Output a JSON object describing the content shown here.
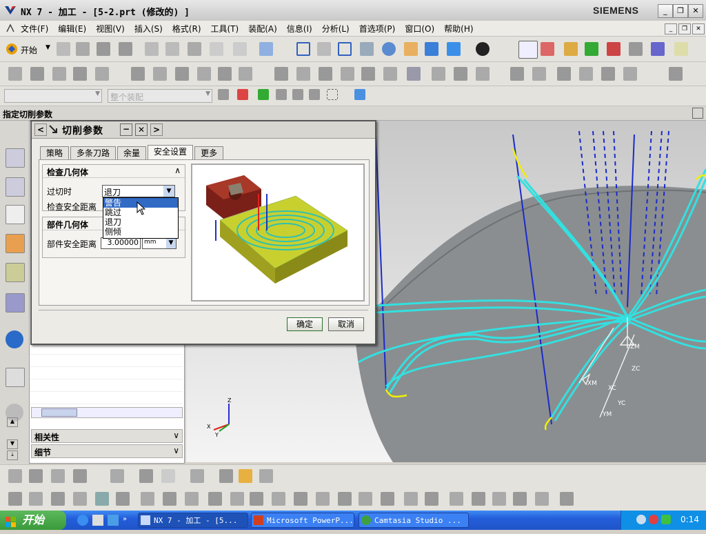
{
  "window": {
    "title": "NX 7 - 加工 - [5-2.prt  (修改的) ]",
    "brand": "SIEMENS"
  },
  "menubar": {
    "items": [
      "文件(F)",
      "编辑(E)",
      "视图(V)",
      "插入(S)",
      "格式(R)",
      "工具(T)",
      "装配(A)",
      "信息(I)",
      "分析(L)",
      "首选项(P)",
      "窗口(O)",
      "帮助(H)"
    ]
  },
  "toolbar": {
    "start_label": "开始",
    "assembly_filter_placeholder": "整个装配"
  },
  "cue_line": {
    "text": "指定切削参数"
  },
  "dialog": {
    "title": "切削参数",
    "tabs": [
      "策略",
      "多条刀路",
      "余量",
      "安全设置",
      "更多"
    ],
    "active_tab": "安全设置",
    "check_geometry": {
      "header": "检查几何体",
      "overcut_label": "过切时",
      "overcut_value": "退刀",
      "check_safe_distance_label": "检查安全距离",
      "options": [
        "警告",
        "跳过",
        "退刀",
        "侧倾"
      ],
      "highlighted_option": "警告"
    },
    "part_geometry": {
      "header": "部件几何体",
      "part_safe_distance_label": "部件安全距离",
      "part_safe_distance_value": "3.00000",
      "unit": "mm"
    },
    "ok_label": "确定",
    "cancel_label": "取消"
  },
  "navigator": {
    "sections": [
      "相关性",
      "细节"
    ]
  },
  "viewport": {
    "axis_labels": [
      "ZM",
      "ZC",
      "XM",
      "XC",
      "YC",
      "YM"
    ],
    "triad_labels": [
      "Z",
      "Y",
      "X"
    ]
  },
  "taskbar": {
    "start_label": "开始",
    "tasks": [
      "NX 7 - 加工 - [5...",
      "Microsoft PowerP...",
      "Camtasia Studio ..."
    ],
    "clock": "0:14"
  },
  "colors": {
    "toolpath": "#33e0e0",
    "toolpath_highlight": "#f0f000",
    "model_gray": "#8a8e90",
    "selection_blue": "#316ac5"
  }
}
